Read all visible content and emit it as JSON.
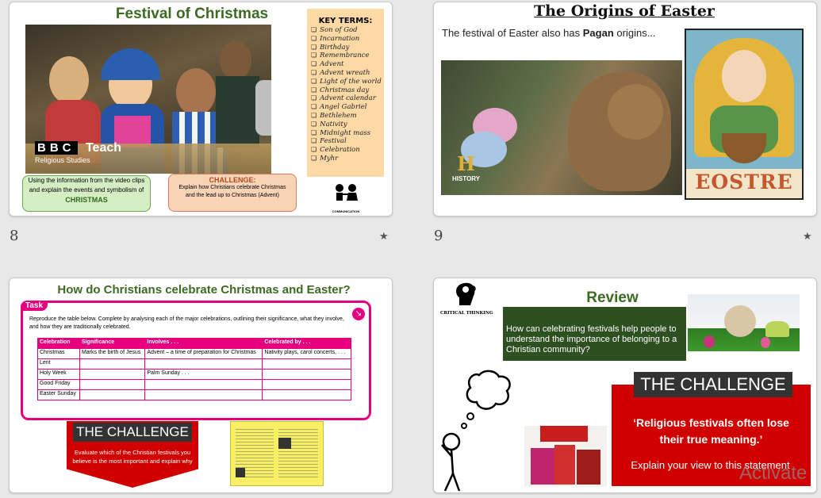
{
  "slides": [
    {
      "number": "8",
      "title": "Festival of Christmas",
      "logo": {
        "brand": "BBC",
        "name": "Teach",
        "sub": "Religious Studies"
      },
      "info_box": {
        "text": "Using the information from the video clips and explain the events and symbolism of",
        "keyword": "CHRISTMAS"
      },
      "challenge_box": {
        "heading": "CHALLENGE:",
        "text": "Explain how Christians celebrate Christmas and the lead up to Christmas (Advent)"
      },
      "key_terms": {
        "heading": "KEY TERMS:",
        "items": [
          "Son of God",
          "Incarnation",
          "Birthday",
          "Remembrance",
          "Advent",
          "Advent wreath",
          "Light of the world",
          "Christmas day",
          "Advent calendar",
          "Angel Gabriel",
          "Bethlehem",
          "Nativity",
          "Midnight mass",
          "Festival",
          "Celebration",
          "Myhr"
        ]
      },
      "communication_label": "COMMUNICATION"
    },
    {
      "number": "9",
      "title": "The Origins of Easter",
      "subtitle_pre": "The festival of Easter also has ",
      "subtitle_bold": "Pagan",
      "subtitle_post": " origins...",
      "history_label": "HISTORY",
      "eostre_label": "EOSTRE"
    },
    {
      "title": "How do Christians celebrate Christmas and Easter?",
      "task_label": "Task",
      "task_text": "Reproduce the table below. Complete by analysing each of the major celebrations, outlining their significance, what they involve, and how they are traditionally celebrated.",
      "table": {
        "headers": [
          "Celebration",
          "Significance",
          "Involves . . .",
          "Celebrated by . . ."
        ],
        "rows": [
          [
            "Christmas",
            "Marks the birth of Jesus",
            "Advent – a time of preparation for Christmas",
            "Nativity plays, carol concerts, . . ."
          ],
          [
            "Lent",
            "",
            "",
            ""
          ],
          [
            "Holy Week",
            "",
            "Palm Sunday . . .",
            ""
          ],
          [
            "Good Friday",
            "",
            "",
            ""
          ],
          [
            "Easter Sunday",
            "",
            "",
            ""
          ]
        ]
      },
      "challenge_title": "THE CHALLENGE",
      "challenge_text": "Evaluate which of the Christian festivals you believe is the most important and explain why"
    },
    {
      "title": "Review",
      "critical_label": "CRITICAL THINKING",
      "question": "How can celebrating festivals help people to understand the importance of belonging to a Christian community?",
      "challenge_title": "THE CHALLENGE",
      "quote": "‘Religious festivals often lose their true meaning.’",
      "instruction": "Explain your view to this statement"
    }
  ],
  "watermark": "Activate",
  "star_glyph": "★"
}
